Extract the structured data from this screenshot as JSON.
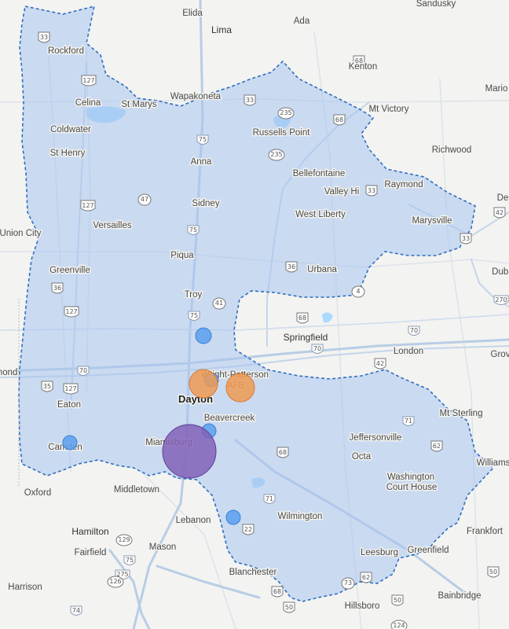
{
  "map": {
    "region_fill": "#a7c4ee",
    "region_stroke": "#2f6fc1",
    "water_color": "#aadaff",
    "highway_color": "#b8cde6",
    "road_color": "#d0dced"
  },
  "places": [
    {
      "id": "sandusky",
      "name": "Sandusky",
      "tier": "minor"
    },
    {
      "id": "elida",
      "name": "Elida",
      "tier": "minor"
    },
    {
      "id": "lima",
      "name": "Lima",
      "tier": "city"
    },
    {
      "id": "ada",
      "name": "Ada",
      "tier": "minor"
    },
    {
      "id": "kenton",
      "name": "Kenton",
      "tier": "minor"
    },
    {
      "id": "rockford",
      "name": "Rockford",
      "tier": "minor"
    },
    {
      "id": "celina",
      "name": "Celina",
      "tier": "minor"
    },
    {
      "id": "st-marys",
      "name": "St Marys",
      "tier": "minor"
    },
    {
      "id": "wapakoneta",
      "name": "Wapakoneta",
      "tier": "minor"
    },
    {
      "id": "marion",
      "name": "Mario",
      "tier": "minor"
    },
    {
      "id": "mt-victory",
      "name": "Mt Victory",
      "tier": "minor"
    },
    {
      "id": "coldwater",
      "name": "Coldwater",
      "tier": "minor"
    },
    {
      "id": "russells-point",
      "name": "Russells Point",
      "tier": "minor"
    },
    {
      "id": "st-henry",
      "name": "St Henry",
      "tier": "minor"
    },
    {
      "id": "anna",
      "name": "Anna",
      "tier": "minor"
    },
    {
      "id": "richwood",
      "name": "Richwood",
      "tier": "minor"
    },
    {
      "id": "bellefontaine",
      "name": "Bellefontaine",
      "tier": "minor"
    },
    {
      "id": "valley-hi",
      "name": "Valley Hi",
      "tier": "minor"
    },
    {
      "id": "raymond",
      "name": "Raymond",
      "tier": "minor"
    },
    {
      "id": "de",
      "name": "De",
      "tier": "minor"
    },
    {
      "id": "sidney",
      "name": "Sidney",
      "tier": "minor"
    },
    {
      "id": "west-liberty",
      "name": "West Liberty",
      "tier": "minor"
    },
    {
      "id": "marysville",
      "name": "Marysville",
      "tier": "minor"
    },
    {
      "id": "union-city",
      "name": "Union City",
      "tier": "minor"
    },
    {
      "id": "versailles",
      "name": "Versailles",
      "tier": "minor"
    },
    {
      "id": "piqua",
      "name": "Piqua",
      "tier": "minor"
    },
    {
      "id": "greenville",
      "name": "Greenville",
      "tier": "minor"
    },
    {
      "id": "urbana",
      "name": "Urbana",
      "tier": "minor"
    },
    {
      "id": "dubl",
      "name": "Dubl",
      "tier": "minor"
    },
    {
      "id": "troy",
      "name": "Troy",
      "tier": "minor"
    },
    {
      "id": "springfield",
      "name": "Springfield",
      "tier": "city"
    },
    {
      "id": "london",
      "name": "London",
      "tier": "minor"
    },
    {
      "id": "grove",
      "name": "Grov",
      "tier": "minor"
    },
    {
      "id": "richmond",
      "name": "mond",
      "tier": "minor"
    },
    {
      "id": "wright-patterson",
      "name": "Wright-Patterson",
      "tier": "minor"
    },
    {
      "id": "afb",
      "name": "AFB",
      "tier": "minor"
    },
    {
      "id": "dayton",
      "name": "Dayton",
      "tier": "major"
    },
    {
      "id": "eaton",
      "name": "Eaton",
      "tier": "minor"
    },
    {
      "id": "beavercreek",
      "name": "Beavercreek",
      "tier": "minor"
    },
    {
      "id": "mt-sterling",
      "name": "Mt Sterling",
      "tier": "minor"
    },
    {
      "id": "jeffersonville",
      "name": "Jeffersonville",
      "tier": "minor"
    },
    {
      "id": "camden",
      "name": "Camden",
      "tier": "minor"
    },
    {
      "id": "miamisburg",
      "name": "Miamisburg",
      "tier": "minor"
    },
    {
      "id": "octa",
      "name": "Octa",
      "tier": "minor"
    },
    {
      "id": "williams",
      "name": "Williams",
      "tier": "minor"
    },
    {
      "id": "washington",
      "name": "Washington",
      "tier": "minor"
    },
    {
      "id": "court-house",
      "name": "Court House",
      "tier": "minor"
    },
    {
      "id": "oxford",
      "name": "Oxford",
      "tier": "minor"
    },
    {
      "id": "middletown",
      "name": "Middletown",
      "tier": "minor"
    },
    {
      "id": "lebanon",
      "name": "Lebanon",
      "tier": "minor"
    },
    {
      "id": "wilmington",
      "name": "Wilmington",
      "tier": "minor"
    },
    {
      "id": "hamilton",
      "name": "Hamilton",
      "tier": "city"
    },
    {
      "id": "frankfort",
      "name": "Frankfort",
      "tier": "minor"
    },
    {
      "id": "mason",
      "name": "Mason",
      "tier": "minor"
    },
    {
      "id": "fairfield",
      "name": "Fairfield",
      "tier": "minor"
    },
    {
      "id": "greenfield",
      "name": "Greenfield",
      "tier": "minor"
    },
    {
      "id": "leesburg",
      "name": "Leesburg",
      "tier": "minor"
    },
    {
      "id": "harrison",
      "name": "Harrison",
      "tier": "minor"
    },
    {
      "id": "blanchester",
      "name": "Blanchester",
      "tier": "minor"
    },
    {
      "id": "bainbridge",
      "name": "Bainbridge",
      "tier": "minor"
    },
    {
      "id": "hillsboro",
      "name": "Hillsboro",
      "tier": "minor"
    }
  ],
  "shields": [
    {
      "id": "s33a",
      "num": "33",
      "type": "us"
    },
    {
      "id": "s68a",
      "num": "68",
      "type": "us"
    },
    {
      "id": "s127a",
      "num": "127",
      "type": "us"
    },
    {
      "id": "s33b",
      "num": "33",
      "type": "us"
    },
    {
      "id": "s68b",
      "num": "68",
      "type": "us"
    },
    {
      "id": "s235a",
      "num": "235",
      "type": "state"
    },
    {
      "id": "s75a",
      "num": "75",
      "type": "interstate"
    },
    {
      "id": "s235b",
      "num": "235",
      "type": "state"
    },
    {
      "id": "s33c",
      "num": "33",
      "type": "us"
    },
    {
      "id": "s127b",
      "num": "127",
      "type": "us"
    },
    {
      "id": "s47",
      "num": "47",
      "type": "state"
    },
    {
      "id": "s75b",
      "num": "75",
      "type": "interstate"
    },
    {
      "id": "s42a",
      "num": "42",
      "type": "us"
    },
    {
      "id": "s33d",
      "num": "33",
      "type": "us"
    },
    {
      "id": "s36a",
      "num": "36",
      "type": "us"
    },
    {
      "id": "s36b",
      "num": "36",
      "type": "us"
    },
    {
      "id": "s4",
      "num": "4",
      "type": "state"
    },
    {
      "id": "s270",
      "num": "270",
      "type": "interstate"
    },
    {
      "id": "s41",
      "num": "41",
      "type": "state"
    },
    {
      "id": "s127c",
      "num": "127",
      "type": "us"
    },
    {
      "id": "s75c",
      "num": "75",
      "type": "interstate"
    },
    {
      "id": "s68c",
      "num": "68",
      "type": "us"
    },
    {
      "id": "s70a",
      "num": "70",
      "type": "interstate"
    },
    {
      "id": "s70b",
      "num": "70",
      "type": "interstate"
    },
    {
      "id": "s70c",
      "num": "70",
      "type": "interstate"
    },
    {
      "id": "s42b",
      "num": "42",
      "type": "us"
    },
    {
      "id": "s35",
      "num": "35",
      "type": "us"
    },
    {
      "id": "s127d",
      "num": "127",
      "type": "us"
    },
    {
      "id": "s71a",
      "num": "71",
      "type": "interstate"
    },
    {
      "id": "s62",
      "num": "62",
      "type": "us"
    },
    {
      "id": "s68d",
      "num": "68",
      "type": "us"
    },
    {
      "id": "s71b",
      "num": "71",
      "type": "interstate"
    },
    {
      "id": "s22",
      "num": "22",
      "type": "us"
    },
    {
      "id": "s129",
      "num": "129",
      "type": "state"
    },
    {
      "id": "s75d",
      "num": "75",
      "type": "interstate"
    },
    {
      "id": "s275",
      "num": "275",
      "type": "interstate"
    },
    {
      "id": "s126",
      "num": "126",
      "type": "state"
    },
    {
      "id": "s74",
      "num": "74",
      "type": "interstate"
    },
    {
      "id": "s68e",
      "num": "68",
      "type": "us"
    },
    {
      "id": "s73",
      "num": "73",
      "type": "state"
    },
    {
      "id": "s62b",
      "num": "62",
      "type": "us"
    },
    {
      "id": "s50a",
      "num": "50",
      "type": "us"
    },
    {
      "id": "s50b",
      "num": "50",
      "type": "us"
    },
    {
      "id": "s50c",
      "num": "50",
      "type": "us"
    },
    {
      "id": "s124",
      "num": "124",
      "type": "state"
    }
  ],
  "markers": [
    {
      "id": "marker-tipp-city",
      "color": "blue"
    },
    {
      "id": "marker-fairborn",
      "color": "blue"
    },
    {
      "id": "marker-dayton",
      "color": "orange"
    },
    {
      "id": "marker-wpafb",
      "color": "orange"
    },
    {
      "id": "marker-beavercreek",
      "color": "blue"
    },
    {
      "id": "marker-camden",
      "color": "blue"
    },
    {
      "id": "marker-miamisburg",
      "color": "purple"
    },
    {
      "id": "marker-lebanon-east",
      "color": "blue"
    }
  ],
  "marker_colors": {
    "blue": "#5a9ff0",
    "orange": "#ef9a55",
    "purple": "#8361b8"
  }
}
